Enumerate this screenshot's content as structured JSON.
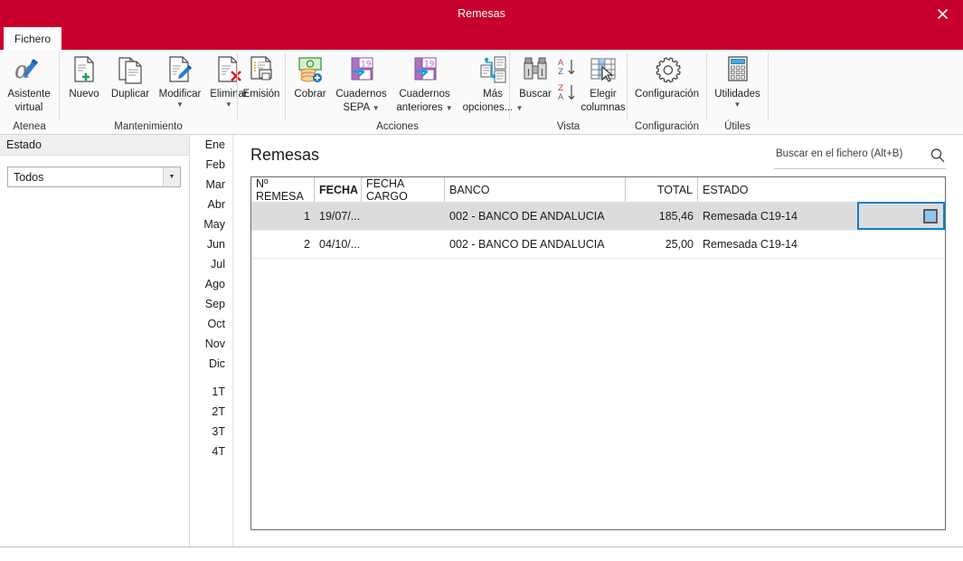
{
  "window": {
    "title": "Remesas",
    "close_label": "✕"
  },
  "tabs": [
    {
      "label": "Fichero",
      "active": true
    }
  ],
  "ribbon": {
    "groups": [
      {
        "name": "atenea",
        "label": "Atenea",
        "buttons": [
          {
            "name": "asistente-virtual",
            "label": "Asistente",
            "label2": "virtual",
            "icon": "alpha-pen-icon",
            "caret": false
          }
        ]
      },
      {
        "name": "mantenimiento",
        "label": "Mantenimiento",
        "buttons": [
          {
            "name": "nuevo",
            "label": "Nuevo",
            "label2": "",
            "icon": "document-plus-icon",
            "caret": false
          },
          {
            "name": "duplicar",
            "label": "Duplicar",
            "label2": "",
            "icon": "document-copy-icon",
            "caret": false
          },
          {
            "name": "modificar",
            "label": "Modificar",
            "label2": "",
            "icon": "document-pencil-icon",
            "caret": true
          },
          {
            "name": "eliminar",
            "label": "Eliminar",
            "label2": "",
            "icon": "document-delete-icon",
            "caret": true
          }
        ]
      },
      {
        "name": "emision",
        "label": "",
        "buttons": [
          {
            "name": "emision",
            "label": "Emisión",
            "label2": "",
            "icon": "document-print-icon",
            "caret": false
          }
        ]
      },
      {
        "name": "acciones",
        "label": "Acciones",
        "buttons": [
          {
            "name": "cobrar",
            "label": "Cobrar",
            "label2": "",
            "icon": "money-coins-icon",
            "caret": false
          },
          {
            "name": "cuadernos-sepa",
            "label": "Cuadernos",
            "label2": "SEPA",
            "icon": "notebook-19-arrow-icon",
            "caret": true
          },
          {
            "name": "cuadernos-anteriores",
            "label": "Cuadernos",
            "label2": "anteriores",
            "icon": "notebook-19-arrow-icon",
            "caret": true
          },
          {
            "name": "mas-opciones",
            "label": "Más",
            "label2": "opciones...",
            "icon": "flow-documents-icon",
            "caret": true
          }
        ]
      },
      {
        "name": "vista",
        "label": "Vista",
        "buttons": [
          {
            "name": "buscar",
            "label": "Buscar",
            "label2": "",
            "icon": "binoculars-icon",
            "caret": false
          },
          {
            "name": "sort-az",
            "label": "",
            "label2": "",
            "icon": "sort-az-icon",
            "caret": false
          },
          {
            "name": "sort-za",
            "label": "",
            "label2": "",
            "icon": "sort-za-icon",
            "caret": false
          },
          {
            "name": "elegir-columnas",
            "label": "Elegir",
            "label2": "columnas",
            "icon": "table-columns-cursor-icon",
            "caret": false
          }
        ]
      },
      {
        "name": "configuracion",
        "label": "Configuración",
        "buttons": [
          {
            "name": "configuracion",
            "label": "Configuración",
            "label2": "",
            "icon": "gear-icon",
            "caret": false
          }
        ]
      },
      {
        "name": "utiles",
        "label": "Útiles",
        "buttons": [
          {
            "name": "utilidades",
            "label": "Utilidades",
            "label2": "",
            "icon": "calculator-icon",
            "caret": true
          }
        ]
      }
    ]
  },
  "sidebar": {
    "header": "Estado",
    "filter": {
      "label": "Estado",
      "value": "Todos",
      "options": [
        "Todos"
      ]
    }
  },
  "periods": {
    "months": [
      "Ene",
      "Feb",
      "Mar",
      "Abr",
      "May",
      "Jun",
      "Jul",
      "Ago",
      "Sep",
      "Oct",
      "Nov",
      "Dic"
    ],
    "quarters": [
      "1T",
      "2T",
      "3T",
      "4T"
    ]
  },
  "main": {
    "title": "Remesas",
    "search": {
      "placeholder": "Buscar en el fichero (Alt+B)",
      "value": ""
    },
    "table": {
      "columns": [
        {
          "key": "num",
          "label": "Nº REMESA",
          "align": "right",
          "sorted": false
        },
        {
          "key": "fecha",
          "label": "FECHA",
          "align": "left",
          "sorted": true
        },
        {
          "key": "fecha_cargo",
          "label": "FECHA CARGO",
          "align": "left",
          "sorted": false
        },
        {
          "key": "banco",
          "label": "BANCO",
          "align": "left",
          "sorted": false
        },
        {
          "key": "total",
          "label": "TOTAL",
          "align": "right",
          "sorted": false
        },
        {
          "key": "estado",
          "label": "ESTADO",
          "align": "left",
          "sorted": false
        }
      ],
      "rows": [
        {
          "num": "1",
          "fecha": "19/07/...",
          "fecha_cargo": "",
          "banco": "002 - BANCO DE ANDALUCIA",
          "total": "185,46",
          "estado": "Remesada C19-14",
          "selected": true
        },
        {
          "num": "2",
          "fecha": "04/10/...",
          "fecha_cargo": "",
          "banco": "002 - BANCO DE ANDALUCIA",
          "total": "25,00",
          "estado": "Remesada C19-14",
          "selected": false
        }
      ]
    }
  },
  "colors": {
    "brand_red": "#c8002e",
    "focus_blue": "#0f80cc",
    "selected_row": "#dcdcdc"
  }
}
